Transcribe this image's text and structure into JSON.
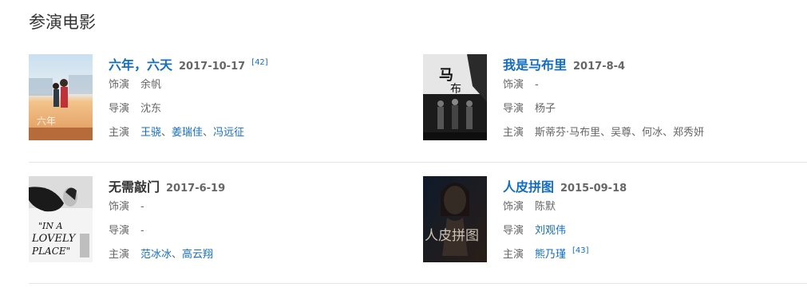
{
  "section": {
    "title": "参演电影"
  },
  "films": [
    {
      "title": "六年，六天",
      "date": "2017-10-17",
      "ref": "[42]",
      "role_label": "饰演",
      "role": "余帆",
      "director_label": "导演",
      "director": "沈东",
      "cast_label": "主演",
      "cast": [
        "王骁",
        "姜瑞佳",
        "冯远征"
      ]
    },
    {
      "title": "我是马布里",
      "date": "2017-8-4",
      "role_label": "饰演",
      "role": "-",
      "director_label": "导演",
      "director": "杨子",
      "cast_label": "主演",
      "cast_text": "斯蒂芬·马布里、吴尊、何冰、郑秀妍"
    },
    {
      "title": "无需敲门",
      "date": "2017-6-19",
      "role_label": "饰演",
      "role": "-",
      "director_label": "导演",
      "director": "-",
      "cast_label": "主演",
      "cast": [
        "范冰冰",
        "高云翔"
      ]
    },
    {
      "title": "人皮拼图",
      "date": "2015-09-18",
      "role_label": "饰演",
      "role": "陈默",
      "director_label": "导演",
      "director": "刘观伟",
      "cast_label": "主演",
      "cast": [
        "熊乃瑾"
      ],
      "cast_ref": "[43]"
    }
  ],
  "posters": {
    "p1_text": "六年",
    "p3_text_1": "\"IN A",
    "p3_text_2": "LOVELY",
    "p3_text_3": "PLACE\"",
    "p4_text": "人皮拼图"
  }
}
